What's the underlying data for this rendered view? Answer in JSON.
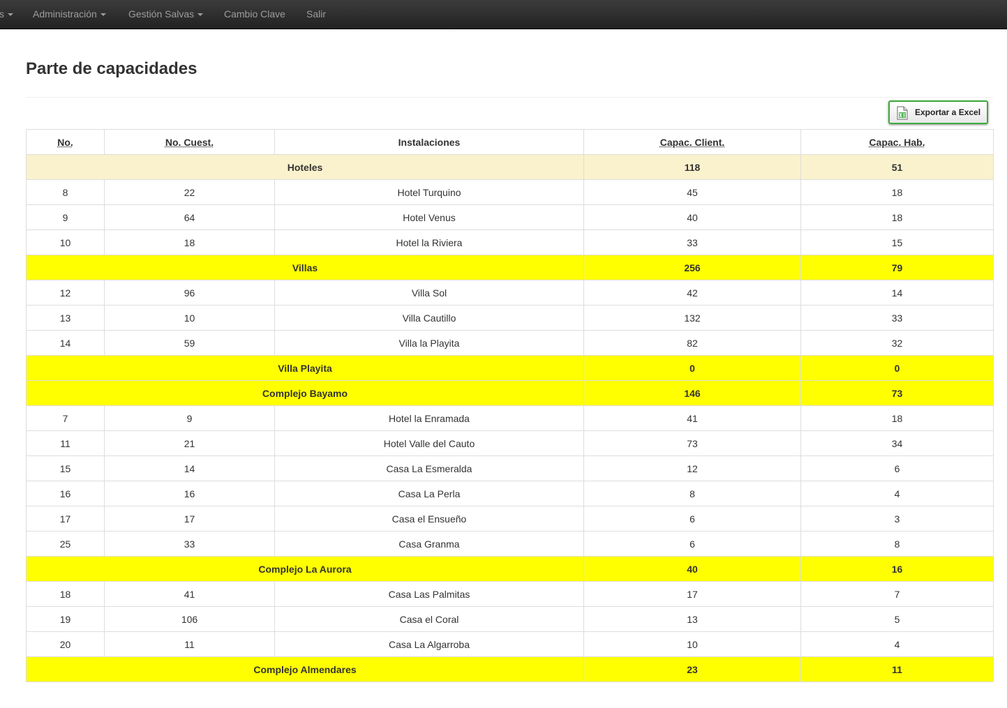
{
  "nav": {
    "partial_label": "s",
    "items": [
      {
        "label": "Administración",
        "dropdown": true
      },
      {
        "label": "Gestión Salvas",
        "dropdown": true
      },
      {
        "label": "Cambio Clave",
        "dropdown": false
      },
      {
        "label": "Salir",
        "dropdown": false
      }
    ]
  },
  "page": {
    "title": "Parte de capacidades",
    "export_button": "Exportar a Excel",
    "export_icon": "excel-file-icon"
  },
  "colors": {
    "navbar": "#222222",
    "group_highlight_beige": "#faf2cc",
    "group_highlight_yellow": "#ffff00",
    "export_border": "#3bab3b"
  },
  "table": {
    "headers": [
      "No.",
      "No. Cuest.",
      "Instalaciones",
      "Capac. Client.",
      "Capac. Hab."
    ],
    "rows": [
      {
        "type": "group",
        "style": "beige",
        "name": "Hoteles",
        "clients": "118",
        "rooms": "51"
      },
      {
        "type": "item",
        "no": "8",
        "cuest": "22",
        "name": "Hotel Turquino",
        "clients": "45",
        "rooms": "18"
      },
      {
        "type": "item",
        "no": "9",
        "cuest": "64",
        "name": "Hotel Venus",
        "clients": "40",
        "rooms": "18"
      },
      {
        "type": "item",
        "no": "10",
        "cuest": "18",
        "name": "Hotel la Riviera",
        "clients": "33",
        "rooms": "15"
      },
      {
        "type": "group",
        "style": "yellow",
        "name": "Villas",
        "clients": "256",
        "rooms": "79"
      },
      {
        "type": "item",
        "no": "12",
        "cuest": "96",
        "name": "Villa Sol",
        "clients": "42",
        "rooms": "14"
      },
      {
        "type": "item",
        "no": "13",
        "cuest": "10",
        "name": "Villa Cautillo",
        "clients": "132",
        "rooms": "33"
      },
      {
        "type": "item",
        "no": "14",
        "cuest": "59",
        "name": "Villa la Playita",
        "clients": "82",
        "rooms": "32"
      },
      {
        "type": "group",
        "style": "yellow",
        "name": "Villa Playita",
        "clients": "0",
        "rooms": "0"
      },
      {
        "type": "group",
        "style": "yellow",
        "name": "Complejo Bayamo",
        "clients": "146",
        "rooms": "73"
      },
      {
        "type": "item",
        "no": "7",
        "cuest": "9",
        "name": "Hotel la Enramada",
        "clients": "41",
        "rooms": "18"
      },
      {
        "type": "item",
        "no": "11",
        "cuest": "21",
        "name": "Hotel Valle del Cauto",
        "clients": "73",
        "rooms": "34"
      },
      {
        "type": "item",
        "no": "15",
        "cuest": "14",
        "name": "Casa La Esmeralda",
        "clients": "12",
        "rooms": "6"
      },
      {
        "type": "item",
        "no": "16",
        "cuest": "16",
        "name": "Casa La Perla",
        "clients": "8",
        "rooms": "4"
      },
      {
        "type": "item",
        "no": "17",
        "cuest": "17",
        "name": "Casa el Ensueño",
        "clients": "6",
        "rooms": "3"
      },
      {
        "type": "item",
        "no": "25",
        "cuest": "33",
        "name": "Casa Granma",
        "clients": "6",
        "rooms": "8"
      },
      {
        "type": "group",
        "style": "yellow",
        "name": "Complejo La Aurora",
        "clients": "40",
        "rooms": "16"
      },
      {
        "type": "item",
        "no": "18",
        "cuest": "41",
        "name": "Casa Las Palmitas",
        "clients": "17",
        "rooms": "7"
      },
      {
        "type": "item",
        "no": "19",
        "cuest": "106",
        "name": "Casa el Coral",
        "clients": "13",
        "rooms": "5"
      },
      {
        "type": "item",
        "no": "20",
        "cuest": "11",
        "name": "Casa La Algarroba",
        "clients": "10",
        "rooms": "4"
      },
      {
        "type": "group",
        "style": "yellow",
        "name": "Complejo Almendares",
        "clients": "23",
        "rooms": "11"
      }
    ]
  }
}
